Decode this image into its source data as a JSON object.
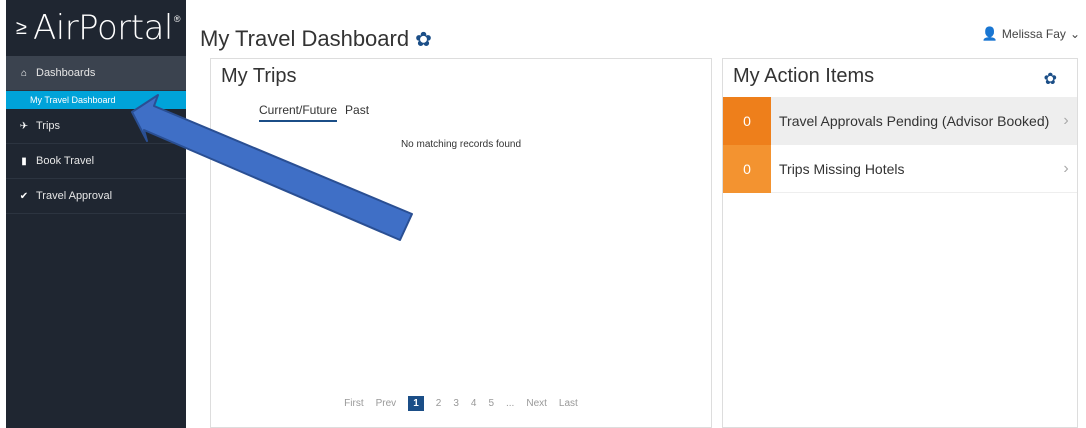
{
  "brand": {
    "name": "AirPortal",
    "registered": "®"
  },
  "sidebar": {
    "items": [
      {
        "label": "Dashboards"
      },
      {
        "label": "My Travel Dashboard"
      },
      {
        "label": "Trips"
      },
      {
        "label": "Book Travel"
      },
      {
        "label": "Travel Approval"
      }
    ]
  },
  "header": {
    "title": "My Travel Dashboard",
    "user": "Melissa Fay"
  },
  "trips": {
    "title": "My Trips",
    "tabs": [
      "Current/Future",
      "Past"
    ],
    "empty": "No matching records found",
    "pager": {
      "first": "First",
      "prev": "Prev",
      "pages": [
        "1",
        "2",
        "3",
        "4",
        "5",
        "..."
      ],
      "next": "Next",
      "last": "Last"
    }
  },
  "actions": {
    "title": "My Action Items",
    "items": [
      {
        "count": "0",
        "label": "Travel Approvals Pending (Advisor Booked)"
      },
      {
        "count": "0",
        "label": "Trips Missing Hotels"
      }
    ]
  },
  "colors": {
    "sidebar": "#1f2631",
    "active_sub": "#00a3d9",
    "accent": "#1b4e87",
    "count": "#ee7f1b",
    "arrow": "#3f6fc6"
  }
}
